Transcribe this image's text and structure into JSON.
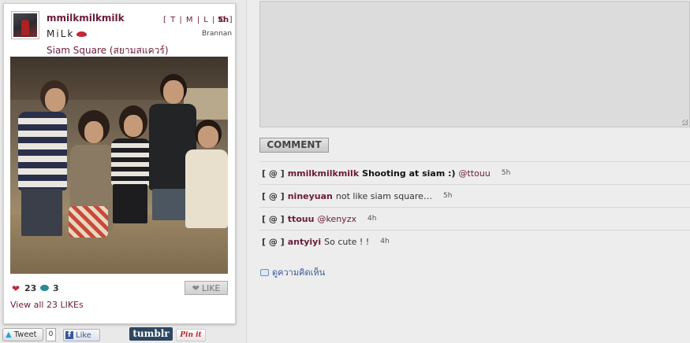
{
  "post": {
    "username": "mmilkmilkmilk",
    "full_name": "MiLk",
    "location": "Siam Square (สยามสแควร์)",
    "nav_links": "[ T | M | L | O ]",
    "time": "5h",
    "filter": "Brannan",
    "likes_count": "23",
    "comments_count": "3",
    "like_button_label": "LIKE",
    "view_all_likes": "View all 23 LIKEs"
  },
  "share": {
    "tweet_label": "Tweet",
    "tweet_count": "0",
    "fb_like_label": "Like",
    "tumblr_label": "tumblr",
    "pinit_label": "Pin it"
  },
  "comment_form": {
    "submit_label": "COMMENT"
  },
  "comments": [
    {
      "badge": "[ @ ]",
      "user": "mmilkmilkmilk",
      "text": "Shooting at siam :)",
      "mention": "@ttouu",
      "time": "5h"
    },
    {
      "badge": "[ @ ]",
      "user": "nineyuan",
      "text": "not like siam square…",
      "mention": "",
      "time": "5h"
    },
    {
      "badge": "[ @ ]",
      "user": "ttouu",
      "text": "",
      "mention": "@kenyzx",
      "time": "4h"
    },
    {
      "badge": "[ @ ]",
      "user": "antyiyi",
      "text": "So cute ! !",
      "mention": "",
      "time": "4h"
    }
  ],
  "view_comments_label": "ดูความคิดเห็น",
  "colors": {
    "accent": "#6b1b3a",
    "heart": "#c0283a",
    "comment_bubble": "#2a8a9a",
    "tumblr": "#2c4762",
    "facebook": "#3b5998"
  },
  "icons": [
    "heart-icon",
    "comment-icon",
    "like-heart-icon",
    "twitter-bird-icon",
    "facebook-icon",
    "speech-bubble-icon",
    "lips-icon"
  ]
}
